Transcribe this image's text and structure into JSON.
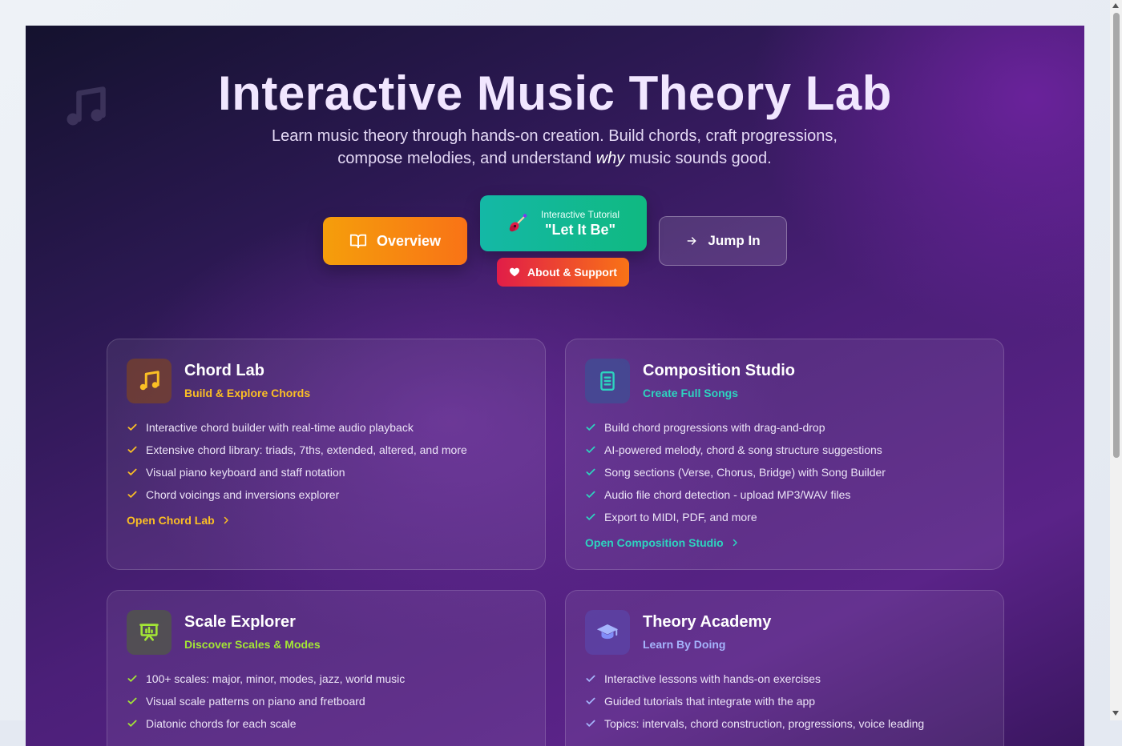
{
  "hero": {
    "title": "Interactive Music Theory Lab",
    "subtitle_part1": "Learn music theory through hands-on creation. Build chords, craft progressions, compose melodies, and understand ",
    "subtitle_em": "why",
    "subtitle_part2": " music sounds good."
  },
  "buttons": {
    "overview": "Overview",
    "tutorial_small": "Interactive Tutorial",
    "tutorial_big": "\"Let It Be\"",
    "about": "About & Support",
    "jump": "Jump In"
  },
  "colors": {
    "amber": "#fbbf24",
    "teal": "#2dd4bf",
    "lime": "#a3e635",
    "periwinkle": "#a5b4fc"
  },
  "cards": [
    {
      "title": "Chord Lab",
      "subtitle": "Build & Explore Chords",
      "icon": "music-note-icon",
      "features": [
        "Interactive chord builder with real-time audio playback",
        "Extensive chord library: triads, 7ths, extended, altered, and more",
        "Visual piano keyboard and staff notation",
        "Chord voicings and inversions explorer"
      ],
      "link": "Open Chord Lab"
    },
    {
      "title": "Composition Studio",
      "subtitle": "Create Full Songs",
      "icon": "document-icon",
      "features": [
        "Build chord progressions with drag-and-drop",
        "AI-powered melody, chord & song structure suggestions",
        "Song sections (Verse, Chorus, Bridge) with Song Builder",
        "Audio file chord detection - upload MP3/WAV files",
        "Export to MIDI, PDF, and more"
      ],
      "link": "Open Composition Studio"
    },
    {
      "title": "Scale Explorer",
      "subtitle": "Discover Scales & Modes",
      "icon": "presentation-chart-icon",
      "features": [
        "100+ scales: major, minor, modes, jazz, world music",
        "Visual scale patterns on piano and fretboard",
        "Diatonic chords for each scale"
      ],
      "link": ""
    },
    {
      "title": "Theory Academy",
      "subtitle": "Learn By Doing",
      "icon": "graduation-cap-icon",
      "features": [
        "Interactive lessons with hands-on exercises",
        "Guided tutorials that integrate with the app",
        "Topics: intervals, chord construction, progressions, voice leading"
      ],
      "link": ""
    }
  ]
}
